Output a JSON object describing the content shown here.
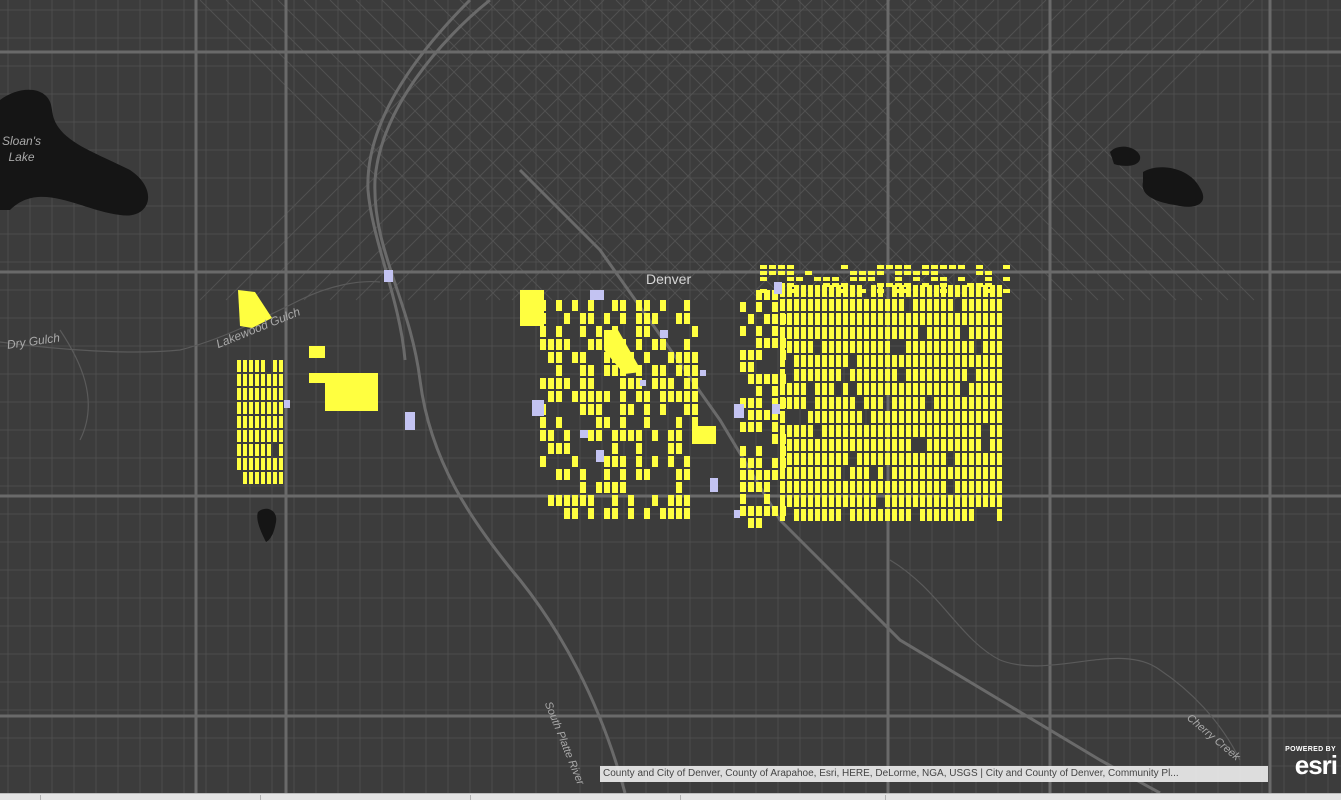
{
  "map": {
    "city_label": "Denver",
    "water_labels": {
      "lake": "Sloan's\nLake",
      "dry_gulch": "Dry Gulch",
      "lakewood_gulch": "Lakewood Gulch",
      "river": "South Platte River",
      "creek": "Cherry Creek"
    },
    "colors": {
      "background": "#3c3c3c",
      "minor_street": "#4f4f4f",
      "major_road": "#6e6e6e",
      "water": "#151515",
      "parcel_primary": "#ffff40",
      "parcel_secondary": "#c3c3f2"
    }
  },
  "attribution": {
    "text": "County and City of Denver, County of Arapahoe, Esri, HERE, DeLorme, NGA, USGS | City and County of Denver, Community Pl..."
  },
  "logo": {
    "powered_by": "POWERED BY",
    "wordmark": "esri"
  }
}
